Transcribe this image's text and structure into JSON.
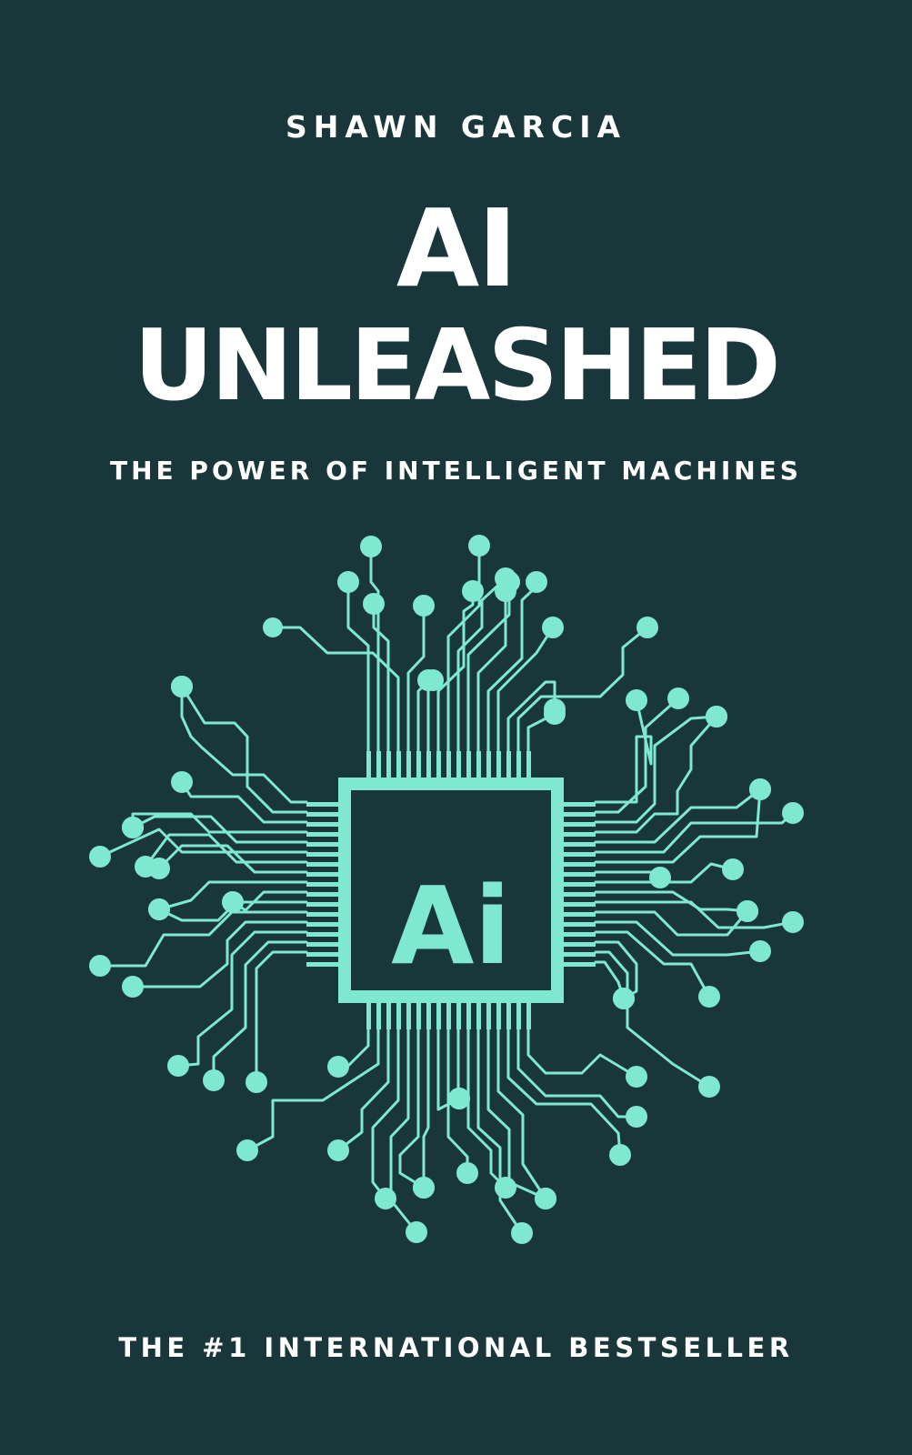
{
  "cover": {
    "author": "SHAWN GARCIA",
    "title_line1": "AI",
    "title_line2": "UNLEASHED",
    "subtitle": "THE POWER OF INTELLIGENT MACHINES",
    "badge_text": "THE #1 INTERNATIONAL BESTSELLER"
  },
  "chip": {
    "label": "Ai",
    "icon": "circuit-chip-icon"
  },
  "colors": {
    "background": "#19363a",
    "accent": "#7ee8d0",
    "text": "#ffffff"
  }
}
